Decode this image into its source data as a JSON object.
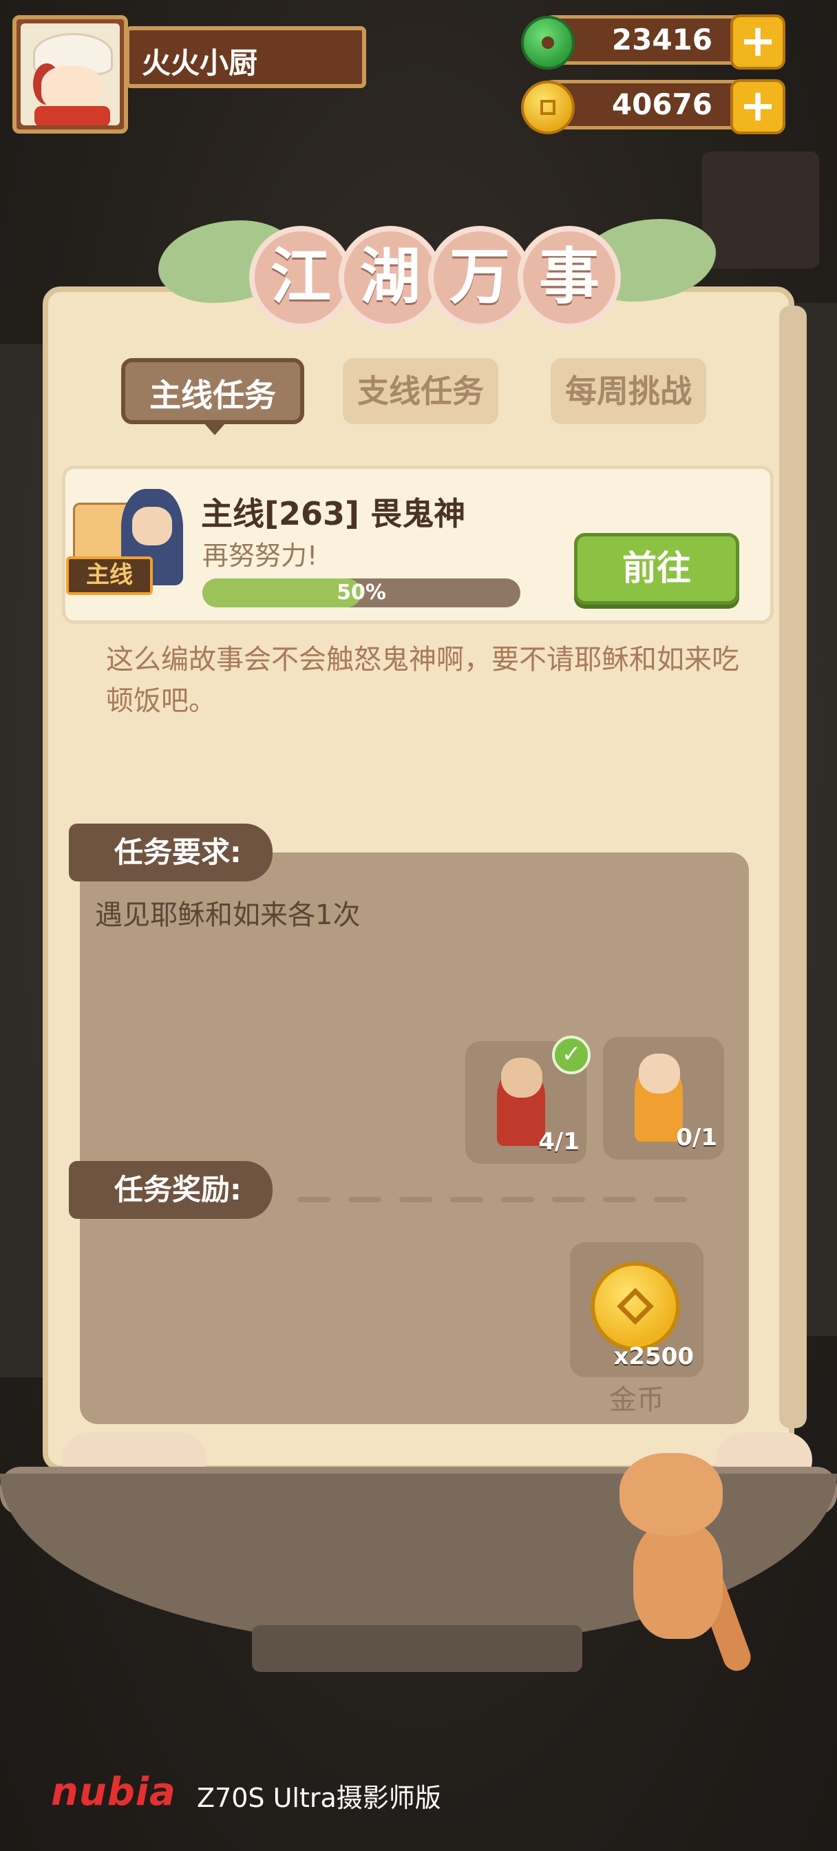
{
  "player": {
    "name": "火火小厨"
  },
  "resources": {
    "jade": {
      "value": "23416",
      "icon": "jade-icon",
      "plus": "+"
    },
    "coins": {
      "value": "40676",
      "icon": "coin-icon",
      "plus": "+"
    }
  },
  "panel": {
    "title_chars": [
      "江",
      "湖",
      "万",
      "事"
    ],
    "tabs": [
      {
        "label": "主线任务",
        "active": true
      },
      {
        "label": "支线任务",
        "active": false
      },
      {
        "label": "每周挑战",
        "active": false
      }
    ]
  },
  "quest": {
    "tag": "主线",
    "title": "主线[263] 畏鬼神",
    "subtitle": "再努努力!",
    "progress_label": "50%",
    "progress": 0.5,
    "go_button": "前往",
    "story": "这么编故事会不会触怒鬼神啊，要不请耶稣和如来吃顿饭吧。"
  },
  "requirements": {
    "header": "任务要求:",
    "text": "遇见耶稣和如来各1次",
    "characters": [
      {
        "count": "4/1",
        "completed": true
      },
      {
        "count": "0/1",
        "completed": false
      }
    ]
  },
  "rewards": {
    "header": "任务奖励:",
    "items": [
      {
        "count": "x2500",
        "name": "金币",
        "icon": "gold-coin-icon"
      }
    ]
  },
  "watermark": {
    "brand": "nubia",
    "model": "Z70S Ultra摄影师版"
  },
  "colors": {
    "accent_green": "#8cc243",
    "panel": "#f3e3c2",
    "brand_red": "#e63030"
  }
}
